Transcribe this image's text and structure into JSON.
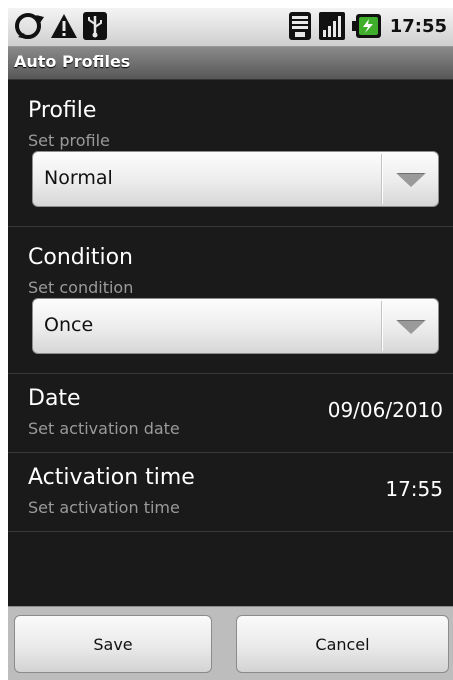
{
  "status_bar": {
    "time": "17:55",
    "left_icons": [
      "sync-icon",
      "warning-icon",
      "usb-icon"
    ],
    "right_icons": [
      "wifi-icon",
      "signal-icon",
      "battery-charging-icon"
    ]
  },
  "title_bar": {
    "title": "Auto Profiles"
  },
  "profile": {
    "title": "Profile",
    "summary": "Set profile",
    "selected": "Normal"
  },
  "condition": {
    "title": "Condition",
    "summary": "Set condition",
    "selected": "Once"
  },
  "date": {
    "title": "Date",
    "summary": "Set activation date",
    "value": "09/06/2010"
  },
  "activation_time": {
    "title": "Activation time",
    "summary": "Set activation time",
    "value": "17:55"
  },
  "buttons": {
    "save_label": "Save",
    "cancel_label": "Cancel"
  },
  "colors": {
    "background": "#1a1a1a",
    "battery_accent": "#3fae2a"
  }
}
